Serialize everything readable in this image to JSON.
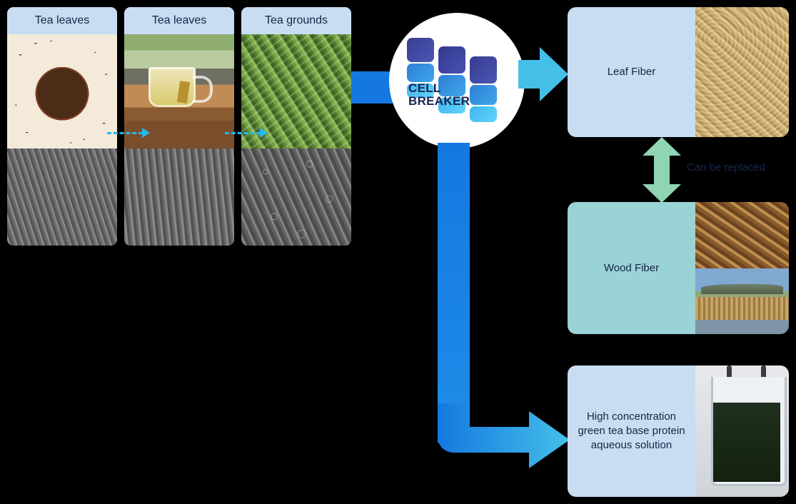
{
  "diagram": {
    "title": "Cell Breaker tea-residue valorization flow",
    "colors": {
      "header_blue": "#c9ddf2",
      "teal": "#9ad3d6",
      "flow_blue": "#1478e0",
      "flow_cyan": "#45bfe8",
      "replace_green": "#8fd4b3",
      "text_navy": "#162447"
    }
  },
  "sources": {
    "cards": [
      {
        "label": "Tea leaves",
        "photo_name": "black-tea-leaves-bowl-photo",
        "sem_name": "sem-micrograph-black-tea"
      },
      {
        "label": "Tea leaves",
        "photo_name": "brewed-tea-cup-photo",
        "sem_name": "sem-micrograph-brewed-tea"
      },
      {
        "label": "Tea grounds",
        "photo_name": "shredded-green-tea-photo",
        "sem_name": "sem-micrograph-tea-grounds"
      }
    ]
  },
  "processor": {
    "brand_line1": "CELL",
    "brand_line2": "BREAKER",
    "logo_name": "cell-breaker-logo",
    "input_arrow_name": "input-feed-arrow",
    "output_arrow_top_name": "output-arrow-to-leaf-fiber",
    "output_arrow_bottom_name": "output-arrow-to-solution"
  },
  "outputs": {
    "leaf_fiber": {
      "label": "Leaf Fiber",
      "image_name": "leaf-fiber-powder-photo"
    },
    "wood_fiber": {
      "label": "Wood Fiber",
      "image_top_name": "wood-chips-photo",
      "image_bottom_name": "log-yard-photo"
    },
    "solution": {
      "label": "High concentration green tea base protein aqueous solution",
      "image_name": "green-tea-protein-beaker-photo"
    }
  },
  "annotations": {
    "replace_label": "Can be replaced",
    "replace_arrow_name": "can-be-replaced-double-arrow"
  }
}
